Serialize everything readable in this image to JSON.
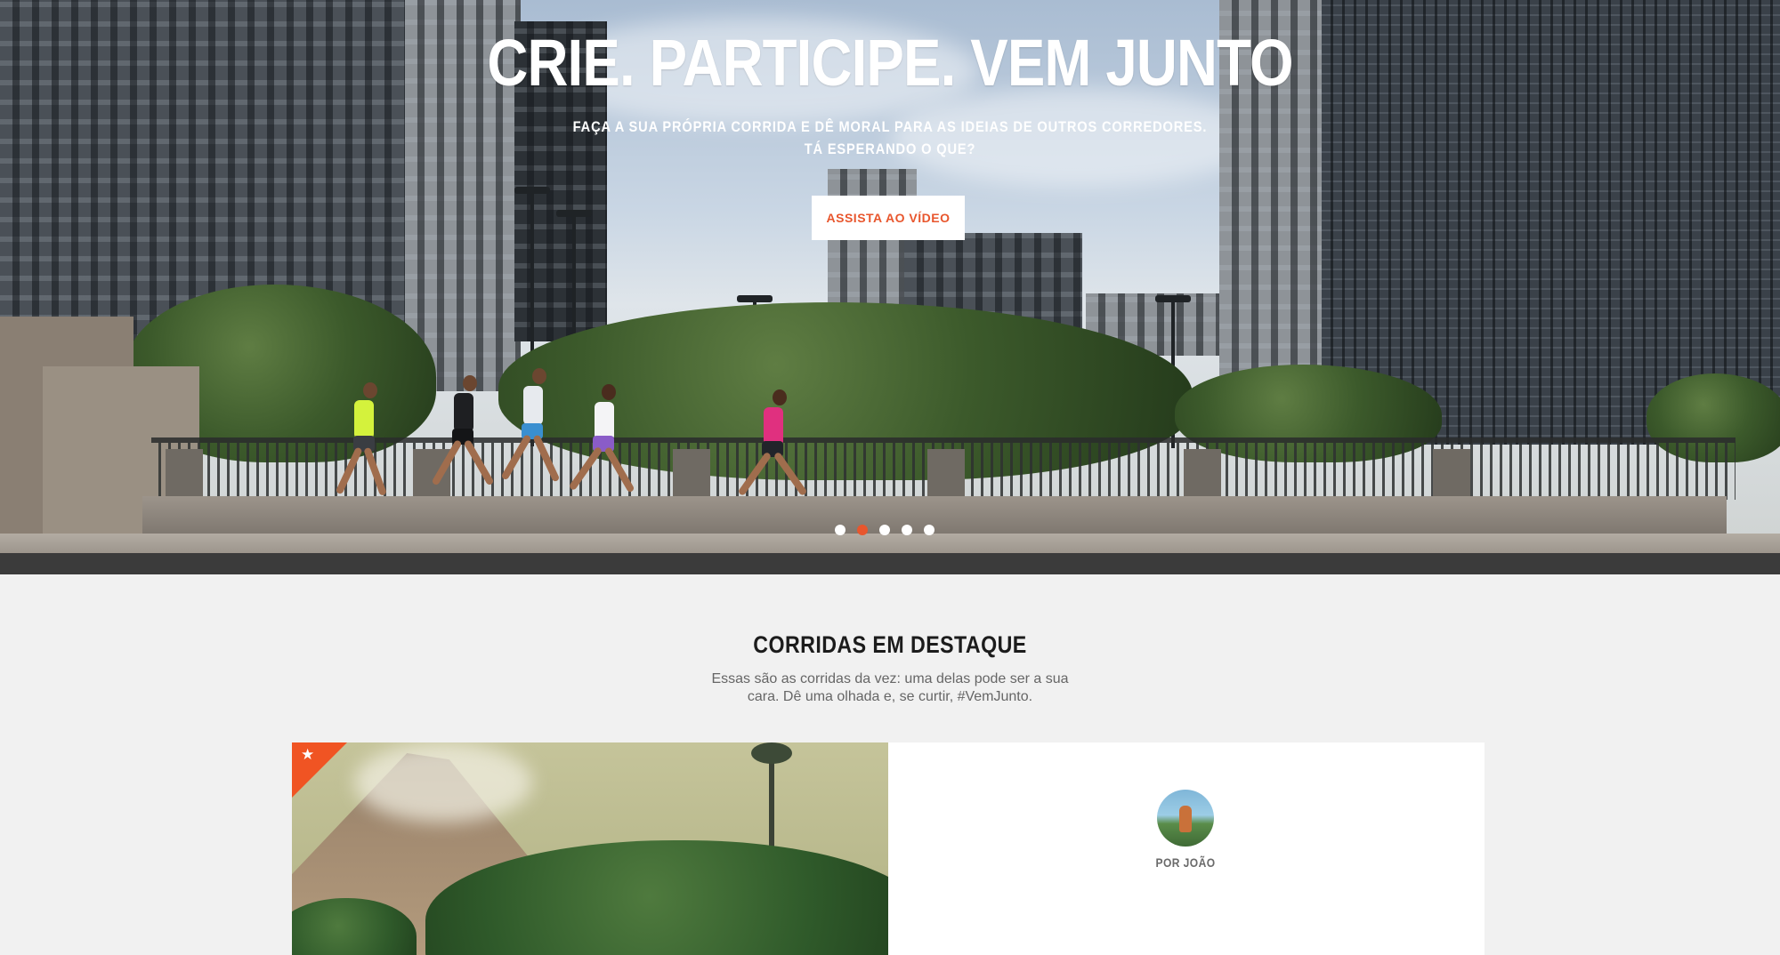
{
  "hero": {
    "title": "CRIE. PARTICIPE. VEM JUNTO",
    "subtitle_line1": "FAÇA A SUA PRÓPRIA CORRIDA E DÊ MORAL PARA AS IDEIAS DE OUTROS CORREDORES.",
    "subtitle_line2": "TÁ ESPERANDO O QUE?",
    "cta_label": "ASSISTA AO VÍDEO",
    "carousel": {
      "slide_count": 5,
      "active_slide": 2
    }
  },
  "featured": {
    "title": "CORRIDAS EM DESTAQUE",
    "description": "Essas são as corridas da vez: uma delas pode ser a sua cara. Dê uma olhada e, se curtir, #VemJunto.",
    "card": {
      "badge_icon": "star-icon",
      "author_label": "POR JOÃO"
    }
  },
  "colors": {
    "accent": "#e8562d",
    "badge": "#f05423",
    "background": "#f1f1f1",
    "dark_band": "#3b3b3b"
  }
}
